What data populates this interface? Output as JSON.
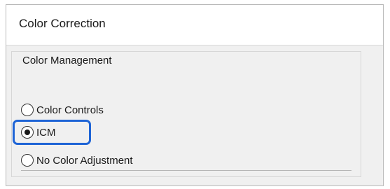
{
  "dialog": {
    "title": "Color Correction"
  },
  "color_management": {
    "legend": "Color Management",
    "options": [
      {
        "label": "Color Controls",
        "selected": false
      },
      {
        "label": "ICM",
        "selected": true
      },
      {
        "label": "No Color Adjustment",
        "selected": false
      }
    ]
  },
  "colors": {
    "highlight_border": "#1e64d6",
    "dialog_background": "#f0f0f0",
    "header_background": "#ffffff"
  }
}
